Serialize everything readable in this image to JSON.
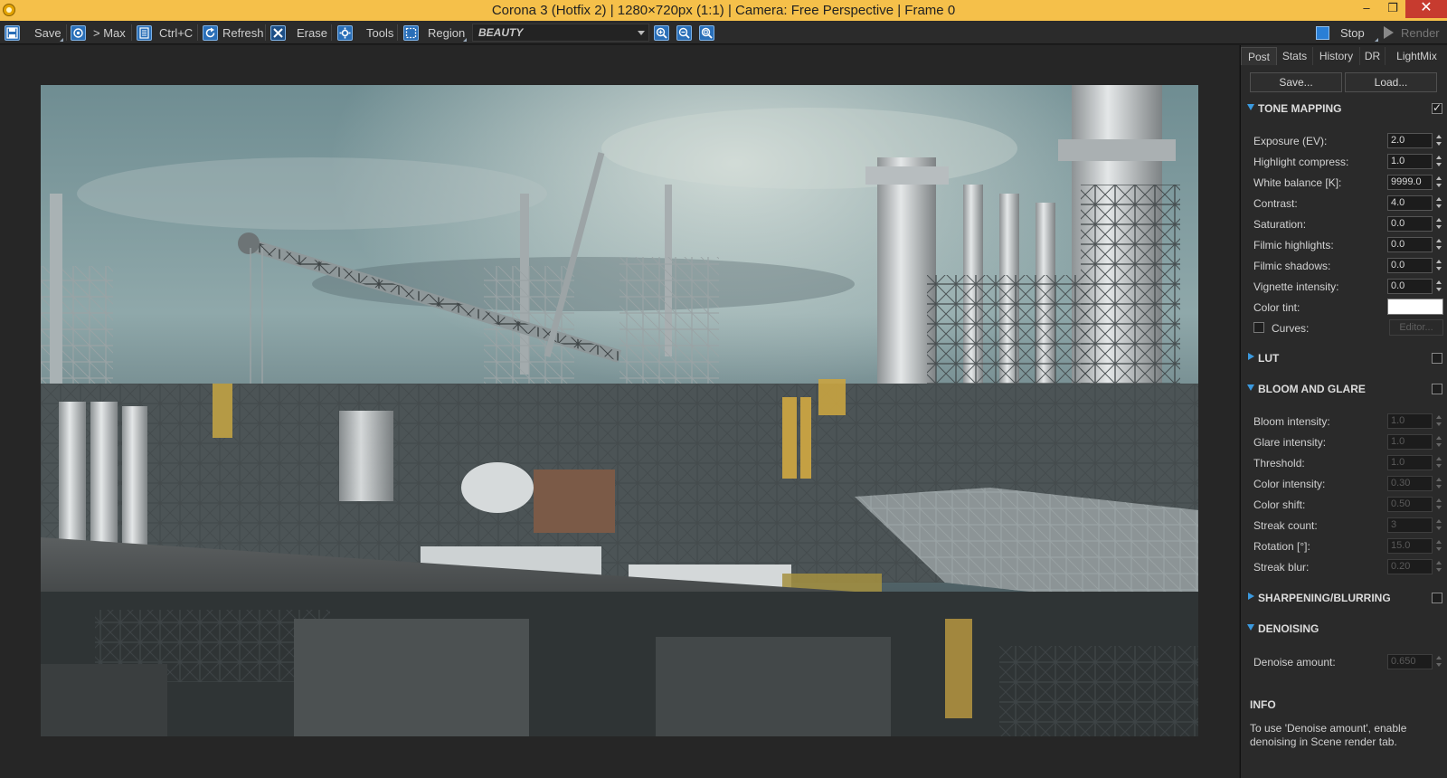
{
  "window": {
    "title": "Corona 3 (Hotfix 2) | 1280×720px (1:1) | Camera: Free Perspective | Frame 0",
    "controls": {
      "minimize": "‒",
      "maximize": "❐",
      "close": "✕"
    }
  },
  "toolbar": {
    "save_label": "Save",
    "max_label": "> Max",
    "copy_label": "Ctrl+C",
    "refresh_label": "Refresh",
    "erase_label": "Erase",
    "tools_label": "Tools",
    "region_label": "Region",
    "render_pass": "BEAUTY",
    "stop_label": "Stop",
    "render_label": "Render",
    "icons": [
      "save-icon",
      "max-icon",
      "copy-icon",
      "refresh-icon",
      "erase-icon",
      "tools-icon",
      "region-icon",
      "zoom-in-icon",
      "zoom-out-icon",
      "zoom-fit-icon"
    ]
  },
  "panel": {
    "tabs": [
      "Post",
      "Stats",
      "History",
      "DR",
      "LightMix"
    ],
    "active_tab": "Post",
    "save_button": "Save...",
    "load_button": "Load...",
    "tone_mapping": {
      "title": "TONE MAPPING",
      "enabled": true,
      "rows": [
        {
          "label": "Exposure (EV):",
          "value": "2.0"
        },
        {
          "label": "Highlight compress:",
          "value": "1.0"
        },
        {
          "label": "White balance [K]:",
          "value": "9999.0"
        },
        {
          "label": "Contrast:",
          "value": "4.0"
        },
        {
          "label": "Saturation:",
          "value": "0.0"
        },
        {
          "label": "Filmic highlights:",
          "value": "0.0"
        },
        {
          "label": "Filmic shadows:",
          "value": "0.0"
        },
        {
          "label": "Vignette intensity:",
          "value": "0.0"
        }
      ],
      "color_tint_label": "Color tint:",
      "color_tint_value": "#ffffff",
      "curves_label": "Curves:",
      "editor_label": "Editor..."
    },
    "lut": {
      "title": "LUT",
      "enabled": false
    },
    "bloom_glare": {
      "title": "BLOOM AND GLARE",
      "enabled": false,
      "rows": [
        {
          "label": "Bloom intensity:",
          "value": "1.0"
        },
        {
          "label": "Glare intensity:",
          "value": "1.0"
        },
        {
          "label": "Threshold:",
          "value": "1.0"
        },
        {
          "label": "Color intensity:",
          "value": "0.30"
        },
        {
          "label": "Color shift:",
          "value": "0.50"
        },
        {
          "label": "Streak count:",
          "value": "3"
        },
        {
          "label": "Rotation [°]:",
          "value": "15.0"
        },
        {
          "label": "Streak blur:",
          "value": "0.20"
        }
      ]
    },
    "sharpening": {
      "title": "SHARPENING/BLURRING",
      "enabled": false
    },
    "denoising": {
      "title": "DENOISING",
      "rows": [
        {
          "label": "Denoise amount:",
          "value": "0.650"
        }
      ]
    },
    "info": {
      "title": "INFO",
      "text": "To use 'Denoise amount', enable denoising in Scene render tab."
    }
  },
  "colors": {
    "title_bar": "#f5c04a",
    "accent_blue": "#3b9ae0",
    "panel_bg": "#2a2a2a",
    "viewport_bg": "#262626"
  }
}
